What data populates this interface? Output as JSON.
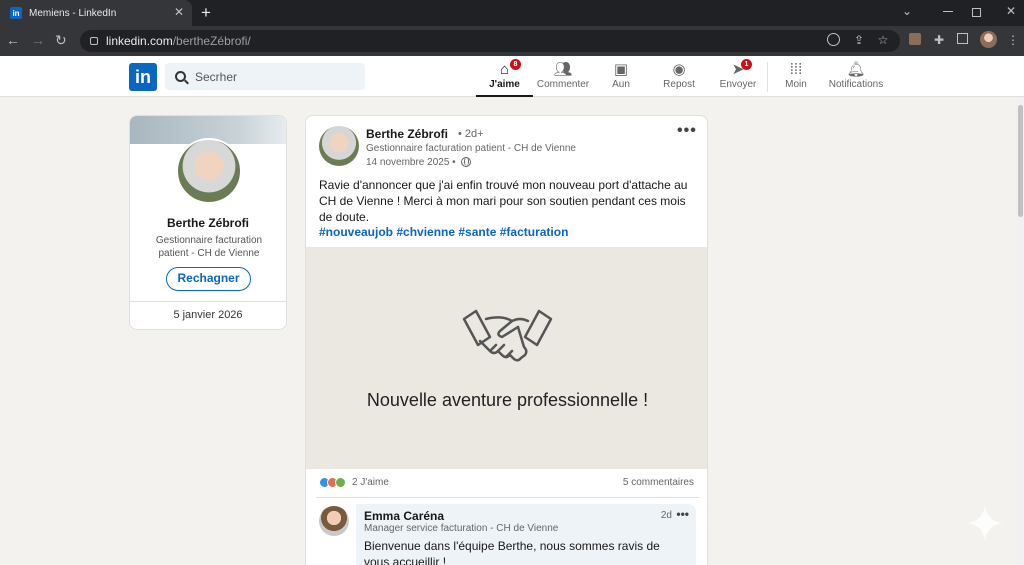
{
  "browser": {
    "tab_title": "Memiens - LinkedIn",
    "tab_close": "✕",
    "new_tab": "+",
    "url_host": "linkedin.com",
    "url_path": "/bertheZébrofi/"
  },
  "header": {
    "logo": "in",
    "search_placeholder": "Secrher",
    "nav": [
      {
        "label": "J'aime",
        "icon": "home-icon",
        "badge": "8",
        "active": true
      },
      {
        "label": "Commenter",
        "icon": "people-icon"
      },
      {
        "label": "Aun",
        "icon": "briefcase-icon"
      },
      {
        "label": "Repost",
        "icon": "chat-icon"
      },
      {
        "label": "Envoyer",
        "icon": "send-icon",
        "badge": "1"
      },
      {
        "label": "Moin",
        "icon": "grid-icon"
      },
      {
        "label": "Notifications",
        "icon": "bell-icon"
      }
    ]
  },
  "profile": {
    "name": "Berthe Zébrofi",
    "title": "Gestionnaire facturation patient - CH de Vienne",
    "button": "Rechagner",
    "date": "5 janvier 2026"
  },
  "post": {
    "author": "Berthe Zébrofi",
    "time": "• 2d+",
    "headline": "Gestionnaire facturation patient - CH de Vienne",
    "date": "14 novembre 2025 •",
    "more": "•••",
    "text": "Ravie d'annoncer que j'ai enfin trouvé mon nouveau port d'attache au CH de Vienne ! Merci à mon mari pour son soutien pendant ces mois de doute.",
    "hashtags": "#nouveaujob #chvienne #sante #facturation",
    "image_caption": "Nouvelle aventure professionnelle !",
    "reactions": "2 J'aime",
    "comments": "5 commentaires"
  },
  "comment": {
    "name": "Emma Caréna",
    "time": "2d",
    "more": "•••",
    "headline": "Manager service facturation - CH de Vienne",
    "text": "Bienvenue dans l'équipe Berthe, nous sommes ravis de vous accueillir !"
  },
  "colors": {
    "brand": "#0a66c2",
    "badge": "#cc1016"
  }
}
